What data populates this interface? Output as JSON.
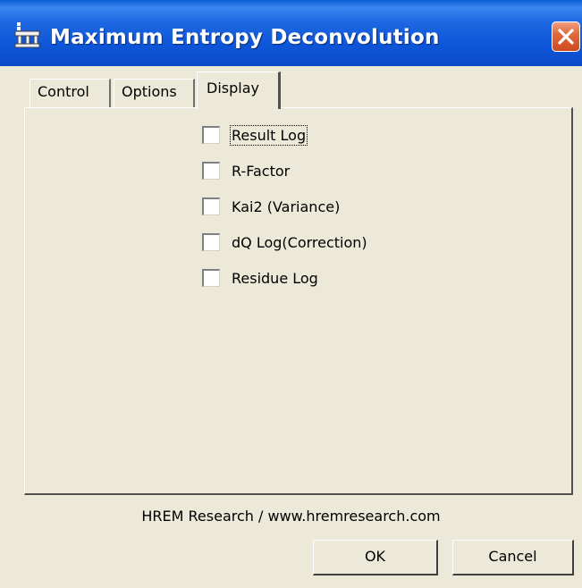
{
  "window": {
    "title": "Maximum Entropy Deconvolution",
    "app_icon": "app-icon",
    "close_icon": "close-icon"
  },
  "tabs": [
    {
      "label": "Control",
      "active": false
    },
    {
      "label": "Options",
      "active": false
    },
    {
      "label": "Display",
      "active": true
    }
  ],
  "display_options": [
    {
      "label": "Result Log",
      "checked": false
    },
    {
      "label": "R-Factor",
      "checked": false
    },
    {
      "label": "Kai2 (Variance)",
      "checked": false
    },
    {
      "label": "dQ Log(Correction)",
      "checked": false
    },
    {
      "label": "Residue Log",
      "checked": false
    }
  ],
  "footer": {
    "credit": "HREM Research / www.hremresearch.com"
  },
  "buttons": {
    "ok_label": "OK",
    "cancel_label": "Cancel"
  },
  "colors": {
    "titlebar": "#0a55d6",
    "dialog_bg": "#ece9d8",
    "close_button": "#e06a3e"
  }
}
